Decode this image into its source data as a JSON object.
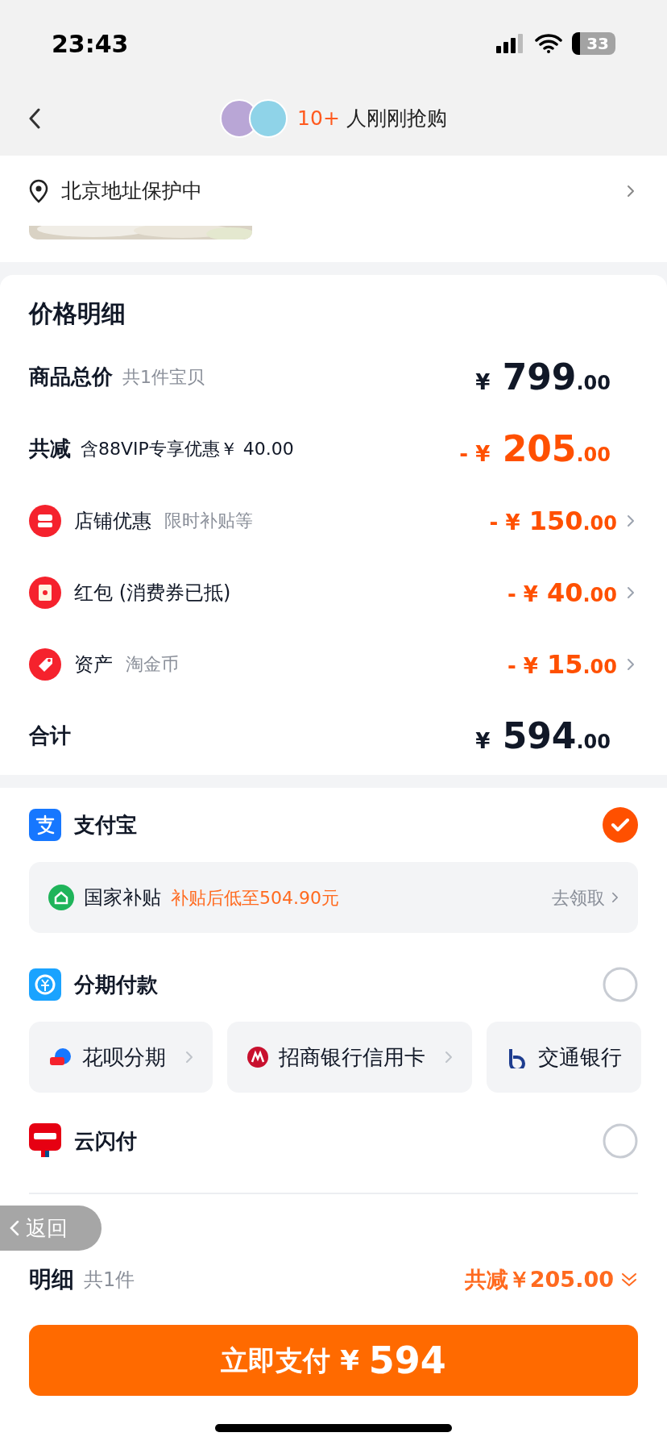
{
  "status_bar": {
    "time": "23:43",
    "battery": "33"
  },
  "nav": {
    "count": "10+",
    "text": "人刚刚抢购"
  },
  "address": {
    "text": "北京地址保护中"
  },
  "price_detail": {
    "title": "价格明细",
    "rows": [
      {
        "kind": "total",
        "label": "商品总价",
        "note": "共1件宝贝",
        "prefix": "¥",
        "integer": "799",
        "decimal": ".00"
      },
      {
        "kind": "discount",
        "label": "共减",
        "note": "含88VIP专享优惠￥ 40.00",
        "prefix": "- ¥",
        "integer": "205",
        "decimal": ".00"
      },
      {
        "kind": "item",
        "label": "店铺优惠",
        "note": "限时补贴等",
        "prefix": "- ¥",
        "integer": "150",
        "decimal": ".00"
      },
      {
        "kind": "item",
        "label": "红包 (消费券已抵)",
        "prefix": "- ¥",
        "integer": "40",
        "decimal": ".00"
      },
      {
        "kind": "item",
        "label": "资产",
        "note": "淘金币",
        "prefix": "- ¥",
        "integer": "15",
        "decimal": ".00"
      },
      {
        "kind": "sum",
        "label": "合计",
        "prefix": "¥",
        "integer": "594",
        "decimal": ".00"
      }
    ]
  },
  "payment": {
    "methods": [
      {
        "label": "支付宝",
        "selected": true,
        "subsidy": {
          "label": "国家补贴",
          "note": "补贴后低至504.90元",
          "action": "去领取"
        }
      },
      {
        "label": "分期付款",
        "selected": false,
        "options": [
          {
            "label": "花呗分期",
            "arrow": true
          },
          {
            "label": "招商银行信用卡",
            "arrow": true
          },
          {
            "label": "交通银行",
            "arrow": false
          }
        ]
      },
      {
        "label": "云闪付",
        "selected": false
      }
    ]
  },
  "back_pill": {
    "label": "返回"
  },
  "footer": {
    "title": "明细",
    "count": "共1件",
    "discount": "共减￥205.00",
    "button": {
      "label": "立即支付",
      "currency": "¥",
      "amount": "594"
    }
  }
}
